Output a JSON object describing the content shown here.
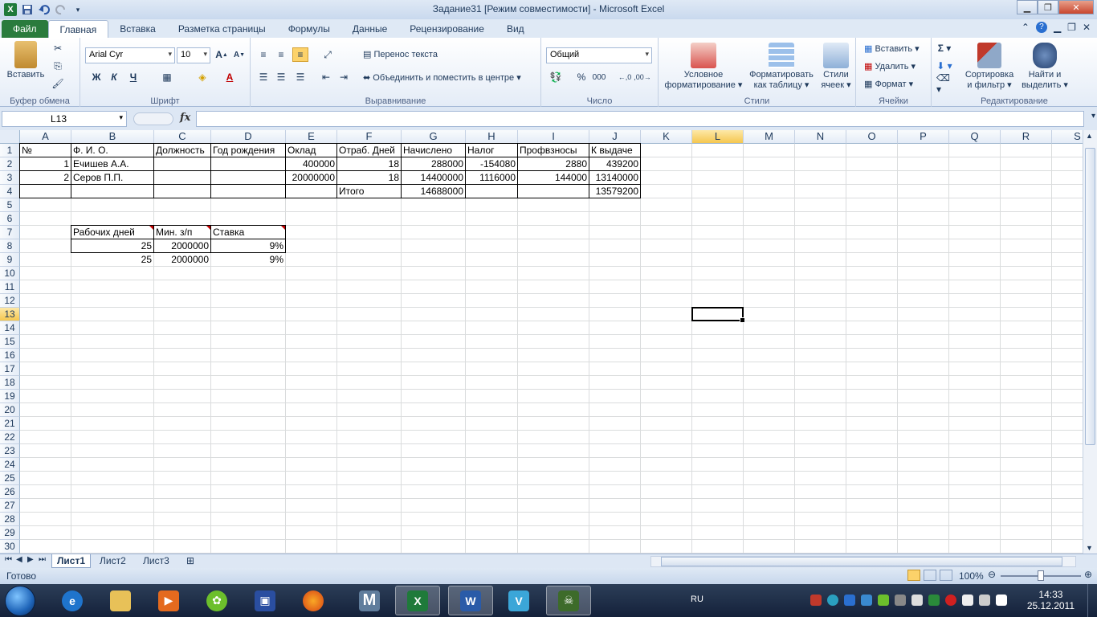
{
  "window": {
    "title": "Задание31  [Режим совместимости]  -  Microsoft Excel"
  },
  "tabs": [
    {
      "label": "Файл"
    },
    {
      "label": "Главная"
    },
    {
      "label": "Вставка"
    },
    {
      "label": "Разметка страницы"
    },
    {
      "label": "Формулы"
    },
    {
      "label": "Данные"
    },
    {
      "label": "Рецензирование"
    },
    {
      "label": "Вид"
    }
  ],
  "ribbon": {
    "clipboard": {
      "label": "Буфер обмена",
      "paste": "Вставить"
    },
    "font": {
      "label": "Шрифт",
      "font_name": "Arial Cyr",
      "font_size": "10",
      "bold": "Ж",
      "italic": "К",
      "underline": "Ч"
    },
    "alignment": {
      "label": "Выравнивание",
      "wrap_text": "Перенос текста",
      "merge_center": "Объединить и поместить в центре"
    },
    "number": {
      "label": "Число",
      "format": "Общий",
      "percent": "%",
      "thousands": "000"
    },
    "styles": {
      "label": "Стили",
      "conditional_1": "Условное",
      "conditional_2": "форматирование",
      "format_table_1": "Форматировать",
      "format_table_2": "как таблицу",
      "cell_styles_1": "Стили",
      "cell_styles_2": "ячеек"
    },
    "cells": {
      "label": "Ячейки",
      "insert": "Вставить",
      "delete": "Удалить",
      "format": "Формат"
    },
    "editing": {
      "label": "Редактирование",
      "sort_1": "Сортировка",
      "sort_2": "и фильтр",
      "find_1": "Найти и",
      "find_2": "выделить"
    }
  },
  "formula_bar": {
    "name_box": "L13",
    "fx": "fx",
    "formula": ""
  },
  "columns": [
    "A",
    "B",
    "C",
    "D",
    "E",
    "F",
    "G",
    "H",
    "I",
    "J",
    "K",
    "L",
    "M",
    "N",
    "O",
    "P",
    "Q",
    "R",
    "S"
  ],
  "rows": [
    "1",
    "2",
    "3",
    "4",
    "5",
    "6",
    "7",
    "8",
    "9",
    "10",
    "11",
    "12",
    "13",
    "14",
    "15",
    "16",
    "17",
    "18",
    "19",
    "20",
    "21",
    "22",
    "23",
    "24",
    "25",
    "26",
    "27",
    "28",
    "29",
    "30"
  ],
  "cells": {
    "A1": "№",
    "B1": "Ф. И. О.",
    "C1": "Должность",
    "D1": "Год рождения",
    "E1": "Оклад",
    "F1": "Отраб. Дней",
    "G1": "Начислено",
    "H1": "Налог",
    "I1": "Профвзносы",
    "J1": "К выдаче",
    "A2": "1",
    "B2": "Ечишев А.А.",
    "E2": "400000",
    "F2": "18",
    "G2": "288000",
    "H2": "-154080",
    "I2": "2880",
    "J2": "439200",
    "A3": "2",
    "B3": "Серов П.П.",
    "E3": "20000000",
    "F3": "18",
    "G3": "14400000",
    "H3": "1116000",
    "I3": "144000",
    "J3": "13140000",
    "F4": "Итого",
    "G4": "14688000",
    "J4": "13579200",
    "B7": "Рабочих дней",
    "C7": "Мин. з/п",
    "D7": "Ставка",
    "B8": "25",
    "C8": "2000000",
    "D8": "9%",
    "B9": "25",
    "C9": "2000000",
    "D9": "9%"
  },
  "selected_cell": "L13",
  "sheets": [
    {
      "label": "Лист1",
      "active": true
    },
    {
      "label": "Лист2"
    },
    {
      "label": "Лист3"
    }
  ],
  "status": {
    "ready": "Готово",
    "zoom": "100%"
  },
  "taskbar": {
    "lang": "RU",
    "time": "14:33",
    "date": "25.12.2011"
  }
}
